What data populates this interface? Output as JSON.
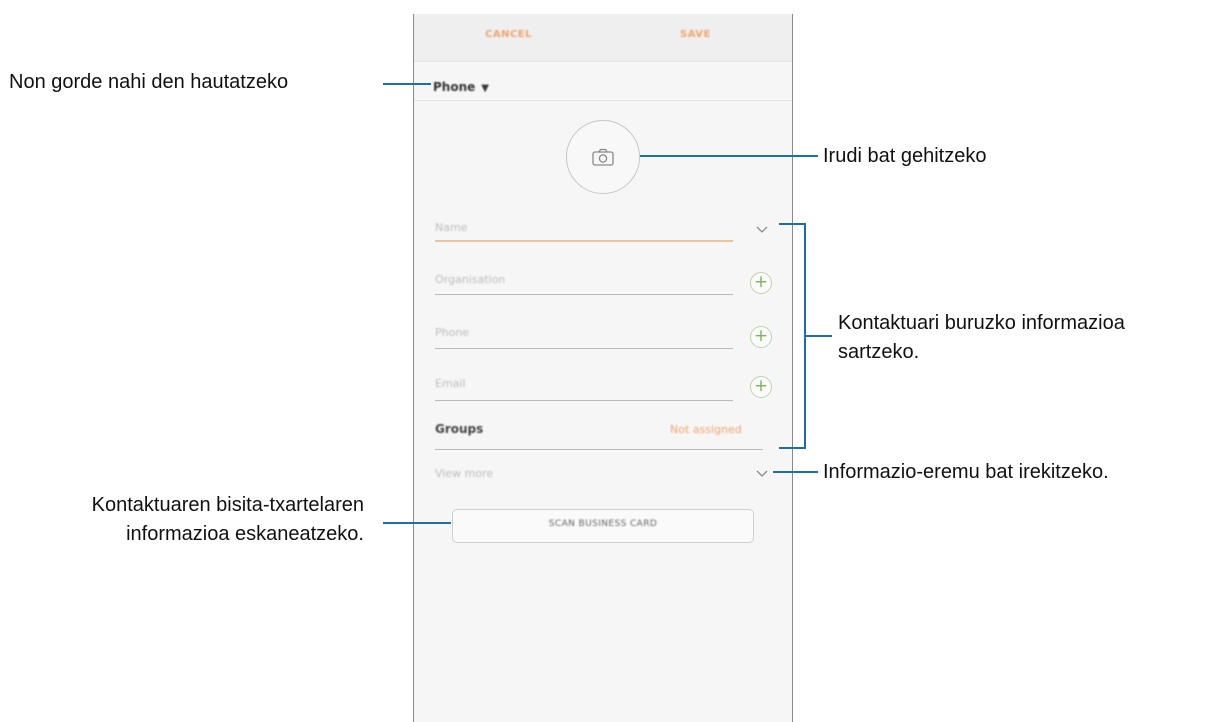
{
  "app": {
    "cancel_label": "CANCEL",
    "save_label": "SAVE",
    "storage_label": "Phone",
    "fields": {
      "name_placeholder": "Name",
      "organisation_placeholder": "Organisation",
      "phone_placeholder": "Phone",
      "email_placeholder": "Email"
    },
    "groups_label": "Groups",
    "groups_value": "Not assigned",
    "view_more_label": "View more",
    "scan_button_label": "SCAN BUSINESS CARD",
    "accent_color": "#f0a46f",
    "add_color": "#7bb35a"
  },
  "callouts": {
    "storage": "Non gorde nahi den hautatzeko",
    "image": "Irudi bat gehitzeko",
    "contact_info_line1": "Kontaktuari buruzko informazioa",
    "contact_info_line2": "sartzeko.",
    "info_field": "Informazio-eremu bat irekitzeko.",
    "scan_line1": "Kontaktuaren bisita-txartelaren",
    "scan_line2": "informazioa eskaneatzeko.",
    "line_color": "#1e6fa9"
  }
}
